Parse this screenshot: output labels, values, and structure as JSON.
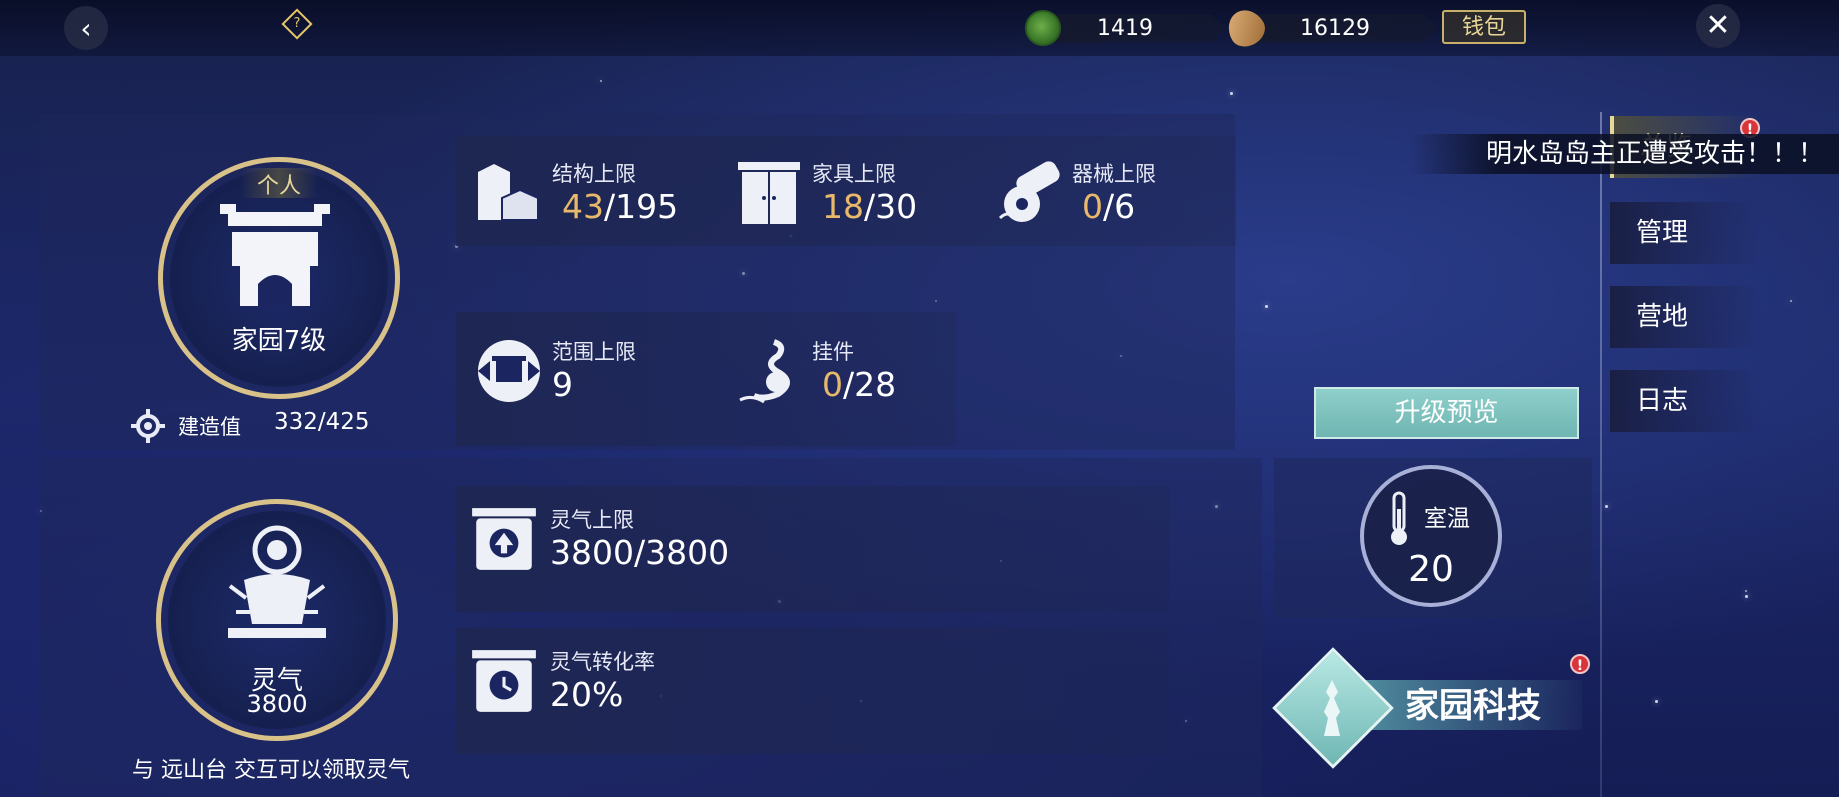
{
  "topbar": {
    "currency_jade": "1419",
    "currency_seed": "16129",
    "wallet_label": "钱包"
  },
  "home": {
    "badge": "个人",
    "level_label": "家园7级",
    "build_label": "建造值",
    "build_value": "332/425",
    "level_ring_progress": 0.78
  },
  "stats": {
    "structure": {
      "label": "结构上限",
      "current": "43",
      "max": "/195"
    },
    "furniture": {
      "label": "家具上限",
      "current": "18",
      "max": "/30"
    },
    "machinery": {
      "label": "器械上限",
      "current": "0",
      "max": "/6"
    },
    "range": {
      "label": "范围上限",
      "value": "9"
    },
    "pendant": {
      "label": "挂件",
      "current": "0",
      "max": "/28"
    }
  },
  "aura": {
    "title": "灵气",
    "value": "3800",
    "hint": "与 远山台 交互可以领取灵气",
    "limit_label": "灵气上限",
    "limit_value": "3800/3800",
    "rate_label": "灵气转化率",
    "rate_value": "20%"
  },
  "sidebar": {
    "items": [
      {
        "label": "总览"
      },
      {
        "label": "管理"
      },
      {
        "label": "营地"
      },
      {
        "label": "日志"
      }
    ],
    "notice": "明水岛岛主正遭受攻击！！！",
    "alert_mark": "!"
  },
  "actions": {
    "upgrade_preview": "升级预览",
    "room_temp_label": "室温",
    "room_temp_value": "20",
    "tech_label": "家园科技"
  },
  "colors": {
    "gold": "#d9c289",
    "highlight": "#e9b96b",
    "teal": "#8fcfcb",
    "alert": "#d8343a"
  }
}
